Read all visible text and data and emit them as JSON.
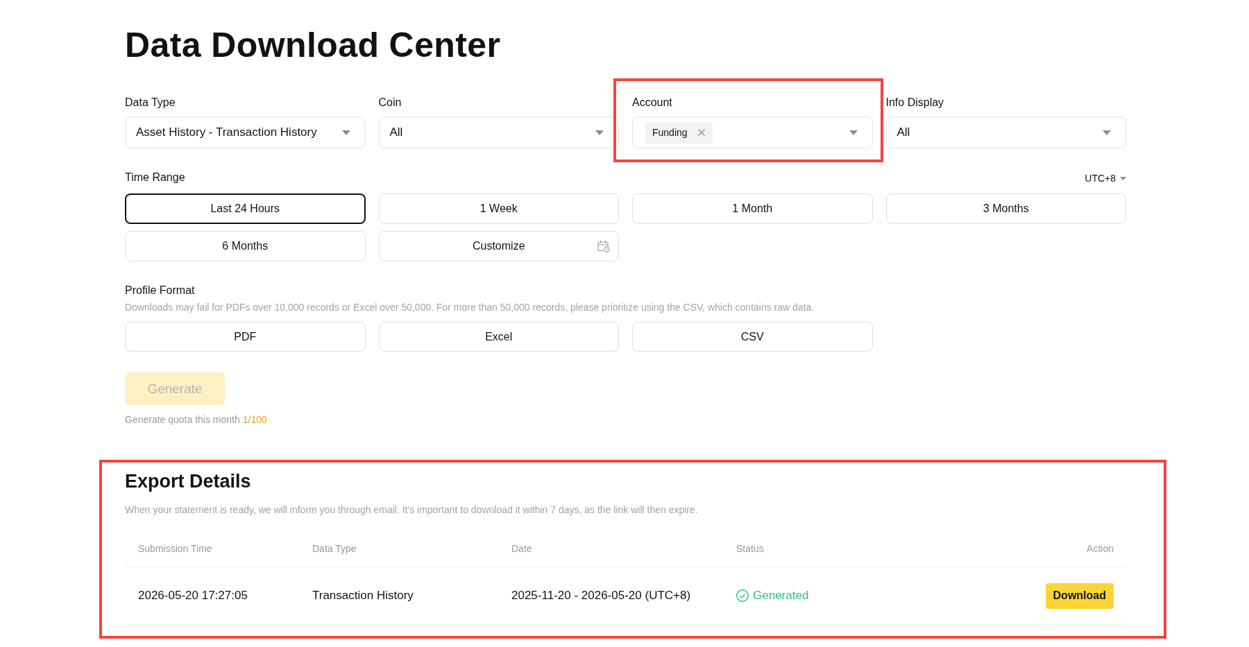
{
  "page": {
    "title": "Data Download Center"
  },
  "filters": [
    {
      "label": "Data Type",
      "kind": "select",
      "value": "Asset History - Transaction History",
      "highlighted": false
    },
    {
      "label": "Coin",
      "kind": "select",
      "value": "All",
      "highlighted": false
    },
    {
      "label": "Account",
      "kind": "tags",
      "tags": [
        "Funding"
      ],
      "highlighted": true
    },
    {
      "label": "Info Display",
      "kind": "select",
      "value": "All",
      "highlighted": false
    }
  ],
  "time_range": {
    "label": "Time Range",
    "timezone": "UTC+8",
    "options": [
      {
        "label": "Last 24 Hours",
        "kind": "preset",
        "selected": true
      },
      {
        "label": "1 Week",
        "kind": "preset",
        "selected": false
      },
      {
        "label": "1 Month",
        "kind": "preset",
        "selected": false
      },
      {
        "label": "3 Months",
        "kind": "preset",
        "selected": false
      },
      {
        "label": "6 Months",
        "kind": "preset",
        "selected": false
      },
      {
        "label": "Customize",
        "kind": "custom",
        "selected": false
      }
    ]
  },
  "profile_format": {
    "label": "Profile Format",
    "hint": "Downloads may fail for PDFs over 10,000 records or Excel over 50,000. For more than 50,000 records, please prioritize using the CSV, which contains raw data.",
    "options": [
      {
        "label": "PDF",
        "selected": false
      },
      {
        "label": "Excel",
        "selected": false
      },
      {
        "label": "CSV",
        "selected": false
      }
    ]
  },
  "generate": {
    "label": "Generate",
    "disabled": true,
    "quota_label": "Generate quota this month",
    "quota_value": "1/100"
  },
  "export_details": {
    "title": "Export Details",
    "highlighted": true,
    "hint": "When your statement is ready, we will inform you through email. It's important to download it within 7 days, as the link will then expire.",
    "columns": [
      "Submission Time",
      "Data Type",
      "Date",
      "Status",
      "Action"
    ],
    "rows": [
      {
        "submission_time": "2026-05-20 17:27:05",
        "data_type": "Transaction History",
        "date": "2025-11-20 - 2026-05-20 (UTC+8)",
        "status": {
          "label": "Generated",
          "kind": "success"
        },
        "action": "Download"
      }
    ]
  }
}
